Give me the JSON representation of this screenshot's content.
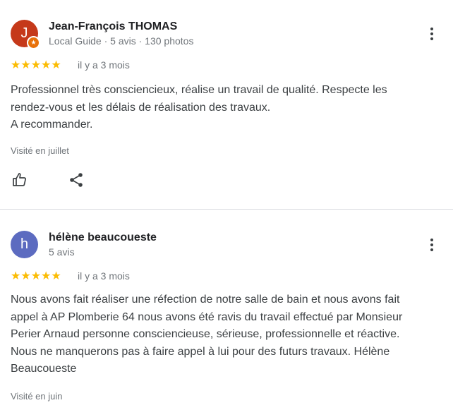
{
  "reviews": [
    {
      "initial": "J",
      "avatar_color": "#c5391a",
      "local_guide_badge": true,
      "name": "Jean-François THOMAS",
      "meta": "Local Guide · 5 avis · 130 photos",
      "stars": "★★★★★",
      "rating": 5,
      "time": "il y a 3 mois",
      "text": "Professionnel très consciencieux, réalise un travail de qualité. Respecte les\nrendez-vous et les délais de réalisation des travaux.\nA recommander.",
      "visited": "Visité en juillet"
    },
    {
      "initial": "h",
      "avatar_color": "#5c6bc0",
      "local_guide_badge": false,
      "name": "hélène beaucoueste",
      "meta": "5 avis",
      "stars": "★★★★★",
      "rating": 5,
      "time": "il y a 3 mois",
      "text": "Nous avons fait réaliser une réfection de notre salle de bain et nous avons fait\nappel à AP Plomberie 64 nous avons été ravis du travail effectué par Monsieur\nPerier Arnaud personne consciencieuse, sérieuse, professionnelle et réactive.\nNous ne manquerons pas à faire appel à lui pour des futurs travaux. Hélène\nBeaucoueste",
      "visited": "Visité en juin"
    }
  ],
  "colors": {
    "star": "#fbbc04",
    "secondary_text": "#70757a",
    "body_text": "#3c4043",
    "divider": "#dadce0"
  },
  "icons": {
    "like": "thumbs-up-icon",
    "share": "share-icon",
    "more": "more-vert-icon",
    "badge": "local-guide-star-icon"
  }
}
